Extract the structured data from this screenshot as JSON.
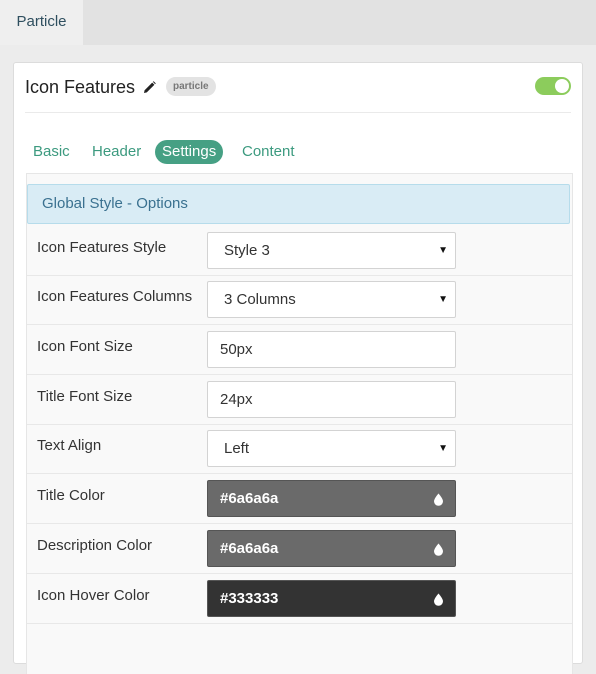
{
  "top_tab": {
    "label": "Particle"
  },
  "panel": {
    "title": "Icon Features",
    "badge": "particle",
    "enabled": true
  },
  "tabs": [
    {
      "label": "Basic"
    },
    {
      "label": "Header"
    },
    {
      "label": "Settings",
      "active": true
    },
    {
      "label": "Content"
    }
  ],
  "section": {
    "title": "Global Style - Options"
  },
  "fields": [
    {
      "label": "Icon Features Style",
      "type": "select",
      "value": "Style 3"
    },
    {
      "label": "Icon Features Columns",
      "type": "select",
      "value": "3 Columns"
    },
    {
      "label": "Icon Font Size",
      "type": "input",
      "value": "50px"
    },
    {
      "label": "Title Font Size",
      "type": "input",
      "value": "24px"
    },
    {
      "label": "Text Align",
      "type": "select",
      "value": "Left"
    },
    {
      "label": "Title Color",
      "type": "color",
      "value": "#6a6a6a"
    },
    {
      "label": "Description Color",
      "type": "color",
      "value": "#6a6a6a"
    },
    {
      "label": "Icon Hover Color",
      "type": "color",
      "value": "#333333"
    }
  ],
  "colors": {
    "accent": "#46a084",
    "toggle_on": "#8ccc5c",
    "section_bg": "#d9ecf5"
  }
}
